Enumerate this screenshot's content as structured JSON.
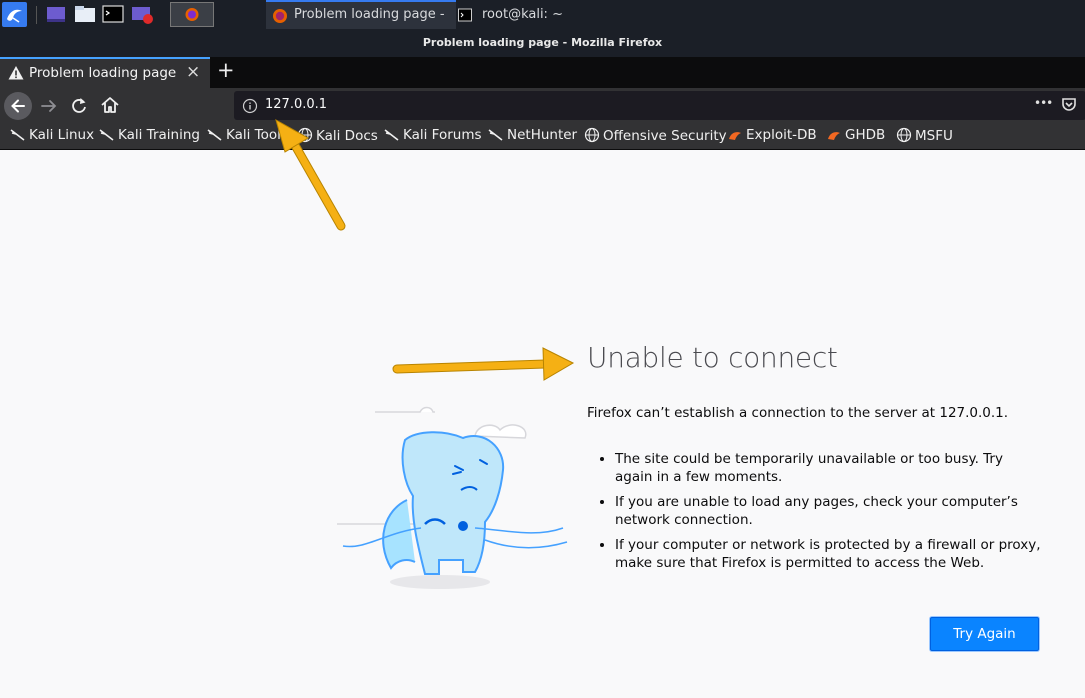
{
  "taskbar": {
    "task_firefox": "Problem loading page - ...",
    "task_terminal": "root@kali: ~"
  },
  "window": {
    "title": "Problem loading page - Mozilla Firefox"
  },
  "tab": {
    "label": "Problem loading page",
    "close": "×",
    "new_tab": "+"
  },
  "navbar": {
    "url": "127.0.0.1",
    "menu": "•••"
  },
  "bookmarks": [
    {
      "label": "Kali Linux",
      "icon": "kali-dragon-icon"
    },
    {
      "label": "Kali Training",
      "icon": "kali-dragon-icon"
    },
    {
      "label": "Kali Tools",
      "icon": "kali-dragon-icon"
    },
    {
      "label": "Kali Docs",
      "icon": "globe-icon"
    },
    {
      "label": "Kali Forums",
      "icon": "kali-dragon-icon"
    },
    {
      "label": "NetHunter",
      "icon": "kali-dragon-icon"
    },
    {
      "label": "Offensive Security",
      "icon": "globe-icon"
    },
    {
      "label": "Exploit-DB",
      "icon": "exploit-db-icon"
    },
    {
      "label": "GHDB",
      "icon": "exploit-db-icon"
    },
    {
      "label": "MSFU",
      "icon": "globe-icon"
    }
  ],
  "error": {
    "title": "Unable to connect",
    "description": "Firefox can’t establish a connection to the server at 127.0.0.1.",
    "items": [
      "The site could be temporarily unavailable or too busy. Try again in a few moments.",
      "If you are unable to load any pages, check your computer’s network connection.",
      "If your computer or network is protected by a firewall or proxy, make sure that Firefox is permitted to access the Web."
    ],
    "button": "Try Again"
  },
  "colors": {
    "accent": "#0a84ff",
    "annotation_arrow": "#f5b014",
    "chrome": "#323234"
  }
}
